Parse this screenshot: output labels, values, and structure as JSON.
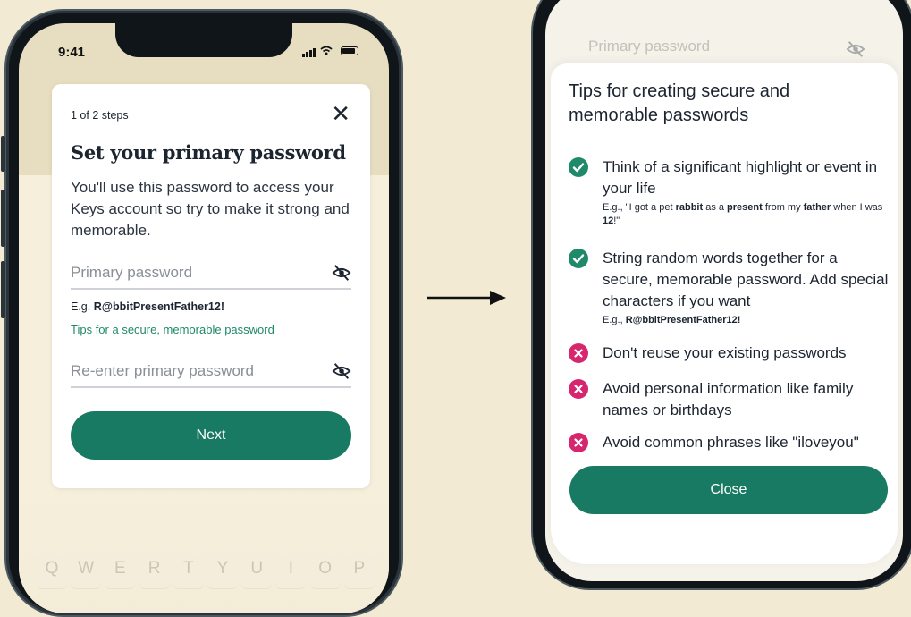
{
  "left_screen": {
    "status": {
      "time": "9:41"
    },
    "step": "1 of 2 steps",
    "title": "Set your primary password",
    "description": "You'll use this password to access your Keys account so try to make it strong and memorable.",
    "password_placeholder": "Primary password",
    "example_prefix": "E.g.",
    "example_value": "R@bbitPresentFather12!",
    "tips_link": "Tips for a secure, memorable password",
    "reenter_placeholder": "Re-enter primary password",
    "next_label": "Next",
    "keyboard_keys": [
      "Q",
      "W",
      "E",
      "R",
      "T",
      "Y",
      "U",
      "I",
      "O",
      "P"
    ]
  },
  "right_screen": {
    "background_field_placeholder": "Primary password",
    "title": "Tips for creating secure and memorable passwords",
    "tips": [
      {
        "kind": "do",
        "text": "Think of a significant highlight or event in your life",
        "example": [
          {
            "t": "E.g., \"I got a pet ",
            "b": false
          },
          {
            "t": "rabbit",
            "b": true
          },
          {
            "t": " as a ",
            "b": false
          },
          {
            "t": "present",
            "b": true
          },
          {
            "t": " from my ",
            "b": false
          },
          {
            "t": "father",
            "b": true
          },
          {
            "t": " when I was ",
            "b": false
          },
          {
            "t": "12",
            "b": true
          },
          {
            "t": "!\"",
            "b": false
          }
        ]
      },
      {
        "kind": "do",
        "text": "String random words together for a secure, memorable password. Add special characters if you want",
        "example": [
          {
            "t": "E.g., ",
            "b": false
          },
          {
            "t": "R@bbitPresentFather12!",
            "b": true
          }
        ]
      },
      {
        "kind": "dont",
        "text": "Don't reuse your existing passwords"
      },
      {
        "kind": "dont",
        "text": "Avoid personal information like family names or birthdays"
      },
      {
        "kind": "dont",
        "text": "Avoid common phrases like \"iloveyou\""
      }
    ],
    "close_label": "Close"
  },
  "colors": {
    "accent": "#197a63",
    "link": "#1f8a6a",
    "error": "#d6266e",
    "page_bg": "#f3ead4"
  }
}
